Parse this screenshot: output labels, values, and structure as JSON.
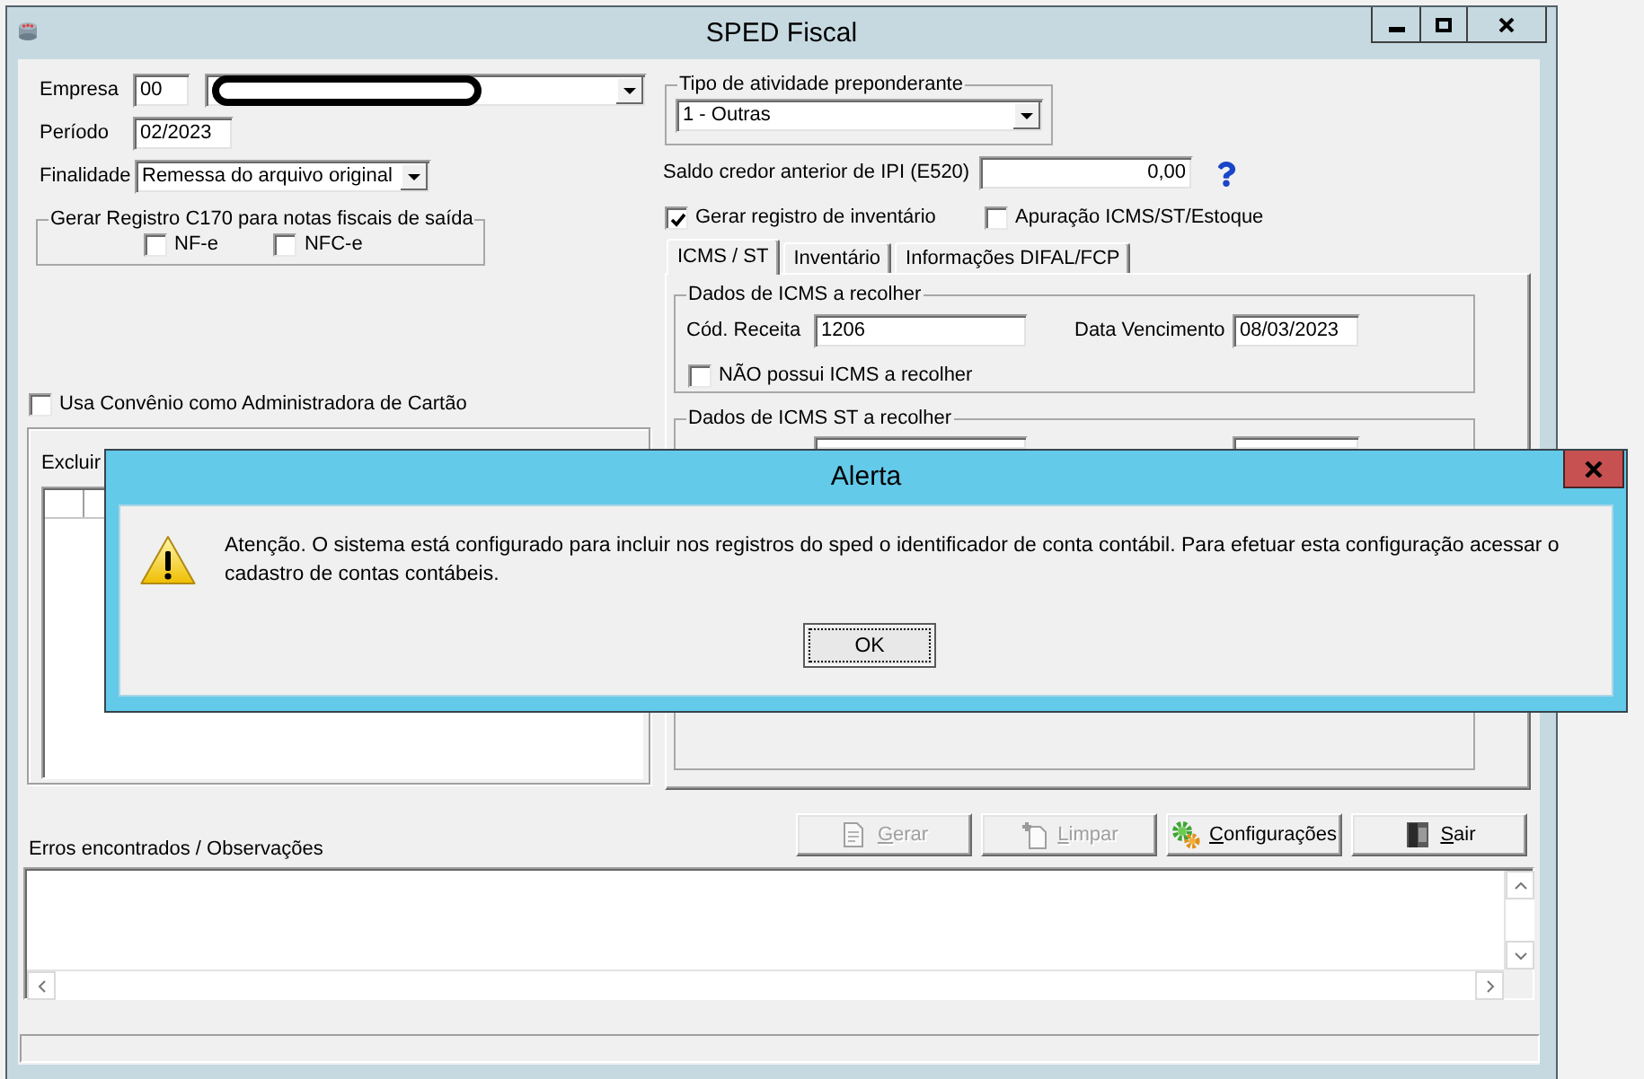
{
  "window": {
    "title": "SPED Fiscal"
  },
  "company": {
    "label": "Empresa",
    "code": "00"
  },
  "period": {
    "label": "Período",
    "value": "02/2023"
  },
  "purpose": {
    "label": "Finalidade",
    "value": "Remessa do arquivo original"
  },
  "c170_group": {
    "title": "Gerar Registro C170 para notas fiscais de saída",
    "options": [
      {
        "label": "NF-e",
        "checked": false
      },
      {
        "label": "NFC-e",
        "checked": false
      }
    ]
  },
  "card_agreement": {
    "label": "Usa Convênio como Administradora de Cartão",
    "checked": false
  },
  "exclude_panel": {
    "label": "Excluir"
  },
  "activity_group": {
    "title": "Tipo de atividade preponderante",
    "value": "1 - Outras"
  },
  "ipi_balance": {
    "label": "Saldo credor anterior de IPI (E520)",
    "value": "0,00"
  },
  "options": [
    {
      "label": "Gerar registro de inventário",
      "checked": true
    },
    {
      "label": "Apuração ICMS/ST/Estoque",
      "checked": false
    }
  ],
  "tabs": [
    {
      "label": "ICMS / ST",
      "selected": true
    },
    {
      "label": "Inventário",
      "selected": false
    },
    {
      "label": "Informações DIFAL/FCP",
      "selected": false
    }
  ],
  "icms_group": {
    "title": "Dados de ICMS a recolher",
    "fields": [
      {
        "label": "Cód. Receita",
        "value": "1206"
      },
      {
        "label": "Data Vencimento",
        "value": "08/03/2023"
      }
    ],
    "no_icms": {
      "label": "NÃO possui ICMS a recolher",
      "checked": false
    }
  },
  "icms_st_group": {
    "title": "Dados de ICMS ST a recolher"
  },
  "buttons": [
    {
      "kind": "generate",
      "label": "Gerar",
      "disabled": true
    },
    {
      "kind": "clear",
      "label": "Limpar",
      "disabled": true
    },
    {
      "kind": "settings",
      "label": "Configurações",
      "disabled": false
    },
    {
      "kind": "exit",
      "label": "Sair",
      "disabled": false
    }
  ],
  "errors": {
    "label": "Erros encontrados / Observações"
  },
  "dialog": {
    "title": "Alerta",
    "message": "Atenção. O sistema está configurado para incluir nos registros do sped o identificador de conta contábil. Para efetuar esta configuração acessar o cadastro de contas contábeis.",
    "button": "OK"
  }
}
